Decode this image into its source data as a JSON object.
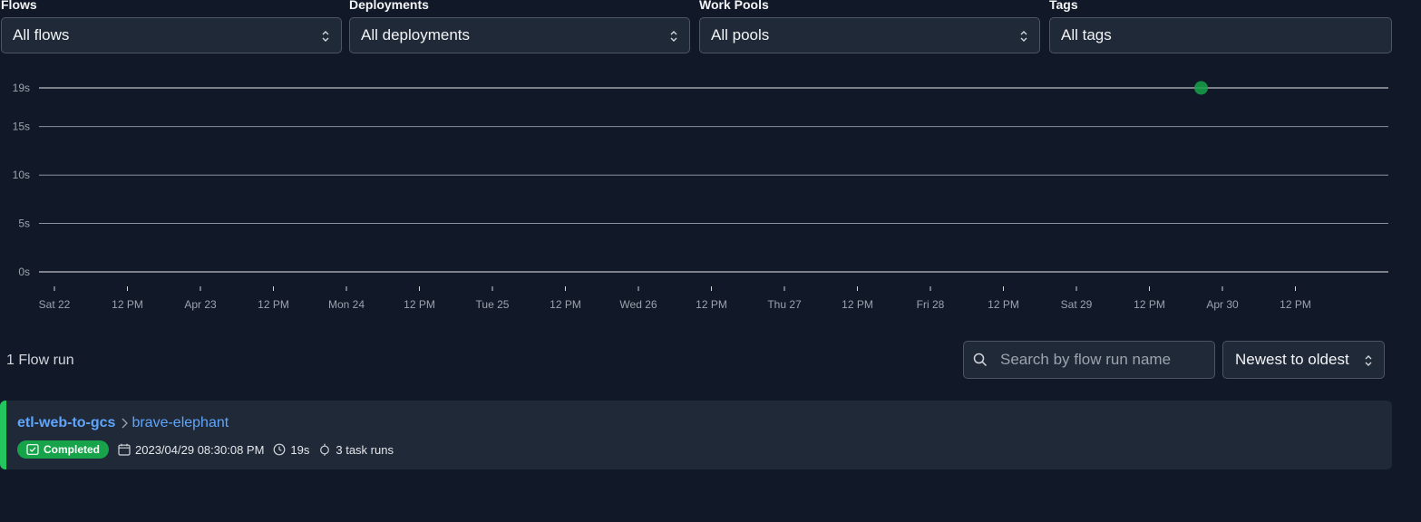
{
  "filters": [
    {
      "label": "Flows",
      "value": "All flows",
      "has_chevron": true
    },
    {
      "label": "Deployments",
      "value": "All deployments",
      "has_chevron": true
    },
    {
      "label": "Work Pools",
      "value": "All pools",
      "has_chevron": true
    },
    {
      "label": "Tags",
      "value": "All tags",
      "has_chevron": false
    }
  ],
  "chart_data": {
    "type": "scatter",
    "y_ticks": [
      "0s",
      "5s",
      "10s",
      "15s",
      "19s"
    ],
    "y_tick_values": [
      0,
      5,
      10,
      15,
      19
    ],
    "ylim": [
      0,
      19
    ],
    "x_ticks": [
      "Sat 22",
      "12 PM",
      "Apr 23",
      "12 PM",
      "Mon 24",
      "12 PM",
      "Tue 25",
      "12 PM",
      "Wed 26",
      "12 PM",
      "Thu 27",
      "12 PM",
      "Fri 28",
      "12 PM",
      "Sat 29",
      "12 PM",
      "Apr 30",
      "12 PM"
    ],
    "points": [
      {
        "x": "2023-04-29 20:30:08",
        "y": 19,
        "state": "Completed"
      }
    ],
    "point_color": "#16a34a",
    "grid": true
  },
  "results": {
    "count_label": "1 Flow run",
    "search_placeholder": "Search by flow run name",
    "sort_value": "Newest to oldest"
  },
  "runs": [
    {
      "flow_name": "etl-web-to-gcs",
      "run_name": "brave-elephant",
      "state": "Completed",
      "start_time": "2023/04/29 08:30:08 PM",
      "duration": "19s",
      "task_runs": "3 task runs"
    }
  ],
  "colors": {
    "background": "#111827",
    "panel": "#1f2937",
    "accent_link": "#60a5fa",
    "completed": "#16a34a"
  }
}
